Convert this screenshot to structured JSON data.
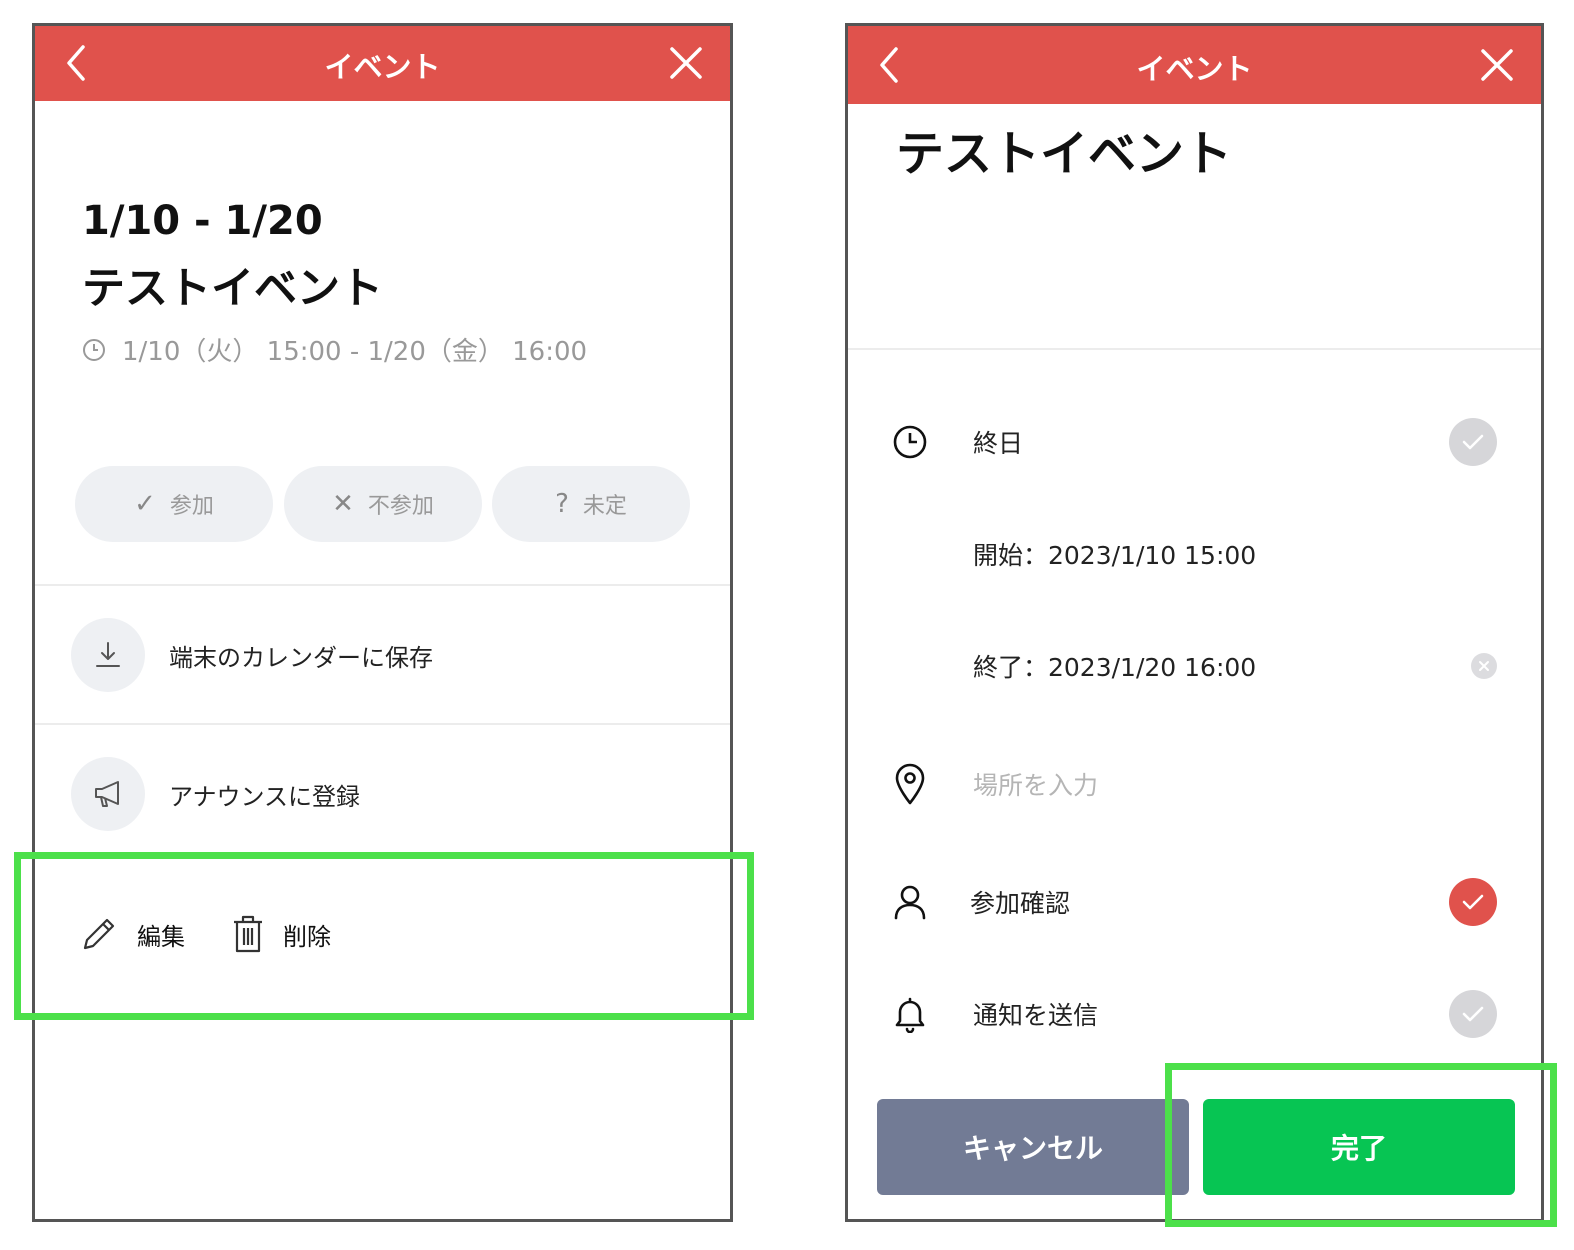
{
  "left": {
    "header": {
      "title": "イベント",
      "back_icon": "chevron-left-icon",
      "close_icon": "close-icon"
    },
    "date_range": "1/10 - 1/20",
    "event_title": "テストイベント",
    "time_text": "1/10（火） 15:00 - 1/20（金） 16:00",
    "rsvp": [
      {
        "symbol": "✓",
        "label": "参加"
      },
      {
        "symbol": "✕",
        "label": "不参加"
      },
      {
        "symbol": "?",
        "label": "未定"
      }
    ],
    "menu": {
      "save_label": "端末のカレンダーに保存",
      "announce_label": "アナウンスに登録"
    },
    "actions": {
      "edit_label": "編集",
      "delete_label": "削除"
    }
  },
  "right": {
    "header": {
      "title": "イベント",
      "back_icon": "chevron-left-icon",
      "close_icon": "close-icon"
    },
    "event_title": "テストイベント",
    "all_day_label": "終日",
    "start_text": "開始：2023/1/10 15:00",
    "end_text": "終了：2023/1/20 16:00",
    "location_placeholder": "場所を入力",
    "attendance_label": "参加確認",
    "notify_label": "通知を送信",
    "cancel_label": "キャンセル",
    "done_label": "完了"
  },
  "colors": {
    "header_red": "#e0524c",
    "done_green": "#07c553",
    "cancel_gray": "#727b95",
    "highlight_green": "#4ce04a"
  }
}
